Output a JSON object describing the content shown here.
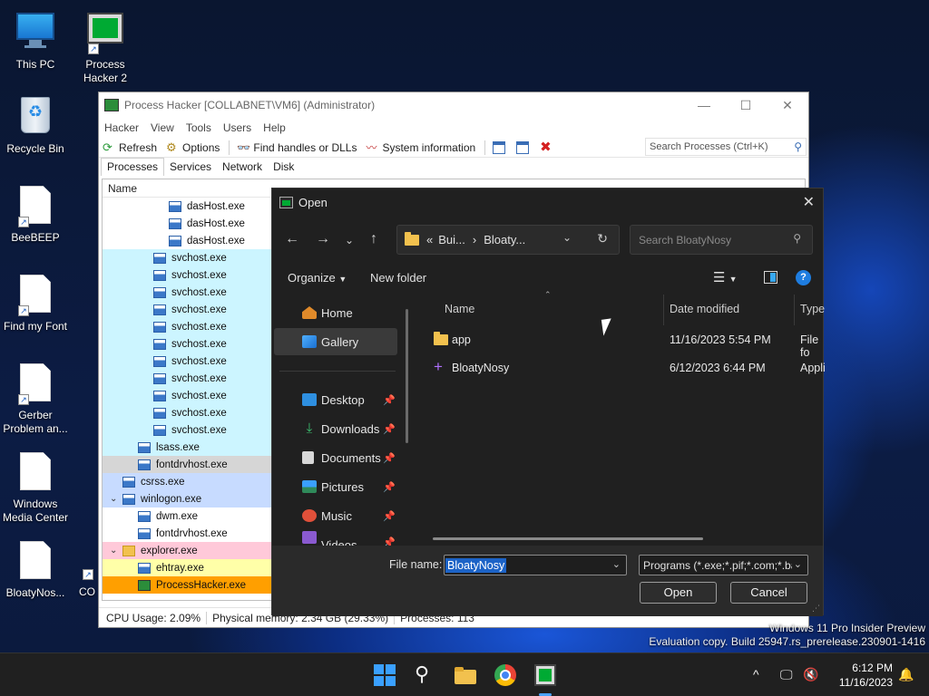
{
  "desktop": {
    "icons": [
      {
        "label": "This PC"
      },
      {
        "label": "Process Hacker 2"
      },
      {
        "label": "Recycle Bin"
      },
      {
        "label": "BeeBEEP"
      },
      {
        "label": "Find my Font"
      },
      {
        "label": "Gerber Problem an..."
      },
      {
        "label": "Windows Media Center"
      },
      {
        "label": "BloatyNos..."
      },
      {
        "label": "CO"
      }
    ],
    "watermark_line1": "Windows 11 Pro Insider Preview",
    "watermark_line2": "Evaluation copy. Build 25947.rs_prerelease.230901-1416"
  },
  "process_hacker": {
    "title": "Process Hacker [COLLABNET\\VM6] (Administrator)",
    "menu": [
      "Hacker",
      "View",
      "Tools",
      "Users",
      "Help"
    ],
    "toolbar": {
      "refresh": "Refresh",
      "options": "Options",
      "find_handles": "Find handles or DLLs",
      "system_info": "System information"
    },
    "search_placeholder": "Search Processes (Ctrl+K)",
    "tabs": [
      "Processes",
      "Services",
      "Network",
      "Disk"
    ],
    "column_name": "Name",
    "processes": [
      {
        "name": "dasHost.exe",
        "indent": 3,
        "color": "white"
      },
      {
        "name": "dasHost.exe",
        "indent": 3,
        "color": "white"
      },
      {
        "name": "dasHost.exe",
        "indent": 3,
        "color": "white"
      },
      {
        "name": "svchost.exe",
        "indent": 2,
        "color": "cyan"
      },
      {
        "name": "svchost.exe",
        "indent": 2,
        "color": "cyan"
      },
      {
        "name": "svchost.exe",
        "indent": 2,
        "color": "cyan"
      },
      {
        "name": "svchost.exe",
        "indent": 2,
        "color": "cyan"
      },
      {
        "name": "svchost.exe",
        "indent": 2,
        "color": "cyan"
      },
      {
        "name": "svchost.exe",
        "indent": 2,
        "color": "cyan"
      },
      {
        "name": "svchost.exe",
        "indent": 2,
        "color": "cyan"
      },
      {
        "name": "svchost.exe",
        "indent": 2,
        "color": "cyan"
      },
      {
        "name": "svchost.exe",
        "indent": 2,
        "color": "cyan"
      },
      {
        "name": "svchost.exe",
        "indent": 2,
        "color": "cyan"
      },
      {
        "name": "svchost.exe",
        "indent": 2,
        "color": "cyan"
      },
      {
        "name": "lsass.exe",
        "indent": 1,
        "color": "cyan"
      },
      {
        "name": "fontdrvhost.exe",
        "indent": 1,
        "color": "gray"
      },
      {
        "name": "csrss.exe",
        "indent": 0,
        "color": "blue"
      },
      {
        "name": "winlogon.exe",
        "indent": 0,
        "color": "blue",
        "expanded": true
      },
      {
        "name": "dwm.exe",
        "indent": 1,
        "color": "white"
      },
      {
        "name": "fontdrvhost.exe",
        "indent": 1,
        "color": "white"
      },
      {
        "name": "explorer.exe",
        "indent": 0,
        "color": "pink",
        "expanded": true
      },
      {
        "name": "ehtray.exe",
        "indent": 1,
        "color": "yellow"
      },
      {
        "name": "ProcessHacker.exe",
        "indent": 1,
        "color": "orange"
      }
    ],
    "status": {
      "cpu": "CPU Usage: 2.09%",
      "memory": "Physical memory: 2.34 GB (29.33%)",
      "processes": "Processes: 113"
    }
  },
  "open_dialog": {
    "title": "Open",
    "breadcrumb": [
      "«",
      "Bui...",
      "›",
      "Bloaty..."
    ],
    "search_placeholder": "Search BloatyNosy",
    "organize": "Organize",
    "new_folder": "New folder",
    "nav": [
      {
        "label": "Home",
        "pinned": false
      },
      {
        "label": "Gallery",
        "pinned": false,
        "selected": true
      },
      {
        "label": "Desktop",
        "pinned": true
      },
      {
        "label": "Downloads",
        "pinned": true
      },
      {
        "label": "Documents",
        "pinned": true
      },
      {
        "label": "Pictures",
        "pinned": true
      },
      {
        "label": "Music",
        "pinned": true
      },
      {
        "label": "Videos",
        "pinned": true
      }
    ],
    "columns": {
      "name": "Name",
      "date": "Date modified",
      "type": "Type"
    },
    "files": [
      {
        "name": "app",
        "date": "11/16/2023 5:54 PM",
        "type": "File fo",
        "kind": "folder"
      },
      {
        "name": "BloatyNosy",
        "date": "6/12/2023 6:44 PM",
        "type": "Appli",
        "kind": "app"
      }
    ],
    "file_name_label": "File name:",
    "file_name_value": "BloatyNosy",
    "filter": "Programs (*.exe;*.pif;*.com;*.bat",
    "open_button": "Open",
    "cancel_button": "Cancel"
  },
  "taskbar": {
    "time": "6:12 PM",
    "date": "11/16/2023"
  },
  "colors": {
    "accent": "#1c63c7",
    "row_cyan": "#ccf5ff",
    "row_blue": "#c7dbff",
    "row_pink": "#ffc9d9",
    "row_yellow": "#ffffa8",
    "row_orange": "#ff9f00",
    "row_gray": "#d6d6d6"
  }
}
